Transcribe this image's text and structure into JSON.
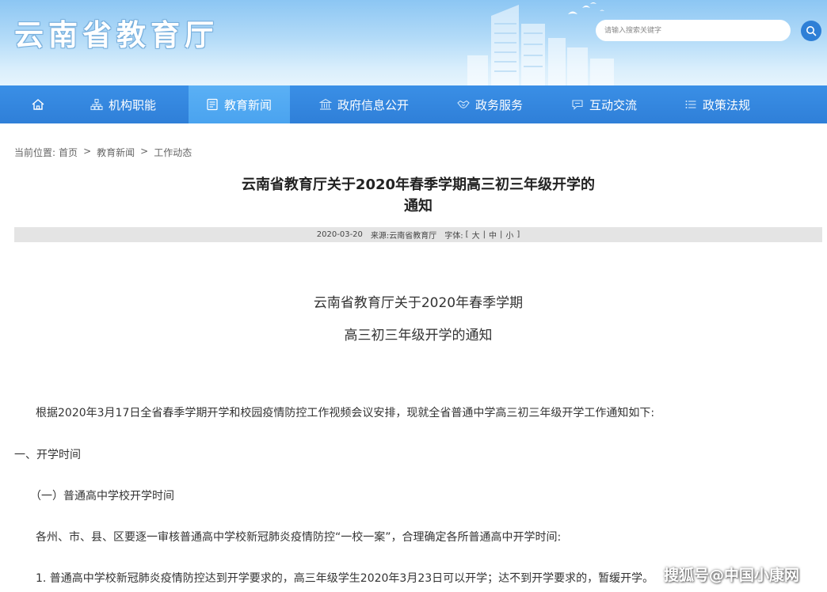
{
  "header": {
    "site_title": "云南省教育厅",
    "search_placeholder": "请输入搜索关键字"
  },
  "nav": {
    "items": [
      {
        "label": "机构职能",
        "icon": "building-org-icon"
      },
      {
        "label": "教育新闻",
        "icon": "newspaper-icon",
        "active": true
      },
      {
        "label": "政府信息公开",
        "icon": "government-icon"
      },
      {
        "label": "政务服务",
        "icon": "handshake-icon"
      },
      {
        "label": "互动交流",
        "icon": "chat-icon"
      },
      {
        "label": "政策法规",
        "icon": "list-icon"
      }
    ]
  },
  "breadcrumb": {
    "prefix": "当前位置:",
    "items": [
      "首页",
      "教育新闻",
      "工作动态"
    ],
    "sep": ">"
  },
  "article": {
    "title_line1": "云南省教育厅关于2020年春季学期高三初三年级开学的",
    "title_line2": "通知",
    "date": "2020-03-20",
    "source": "来源:云南省教育厅",
    "font_label": "字体:",
    "font_open": "[",
    "font_large": "大",
    "font_medium": "中",
    "font_small": "小",
    "font_close": "]",
    "font_divider": "|",
    "sub_title_line1": "云南省教育厅关于2020年春季学期",
    "sub_title_line2": "高三初三年级开学的通知",
    "paragraphs": [
      "根据2020年3月17日全省春季学期开学和校园疫情防控工作视频会议安排，现就全省普通中学高三初三年级开学工作通知如下:",
      "一、开学时间",
      "（一）普通高中学校开学时间",
      "各州、市、县、区要逐一审核普通高中学校新冠肺炎疫情防控“一校一案”，合理确定各所普通高中开学时间:",
      "1. 普通高中学校新冠肺炎疫情防控达到开学要求的，高三年级学生2020年3月23日可以开学；达不到开学要求的，暂缓开学。"
    ]
  },
  "watermark": "搜狐号@中国小康网",
  "colors": {
    "nav_bg": "#2f7fd8",
    "nav_active": "#4aa3ef",
    "search_button": "#2e7fd6",
    "meta_bar": "#e4e4e4"
  }
}
